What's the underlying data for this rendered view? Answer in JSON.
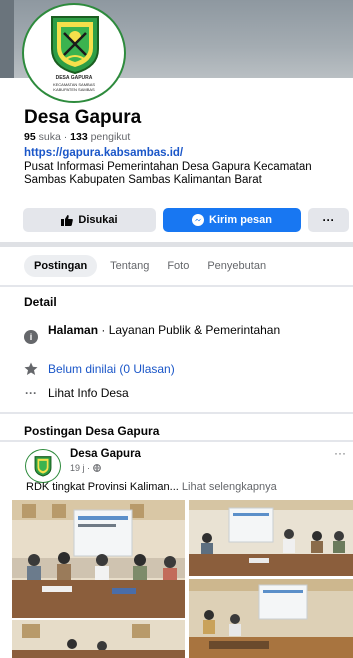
{
  "page": {
    "name": "Desa Gapura",
    "likes_count": "95",
    "likes_label": "suka",
    "followers_count": "133",
    "followers_label": "pengikut",
    "url": "https://gapura.kabsambas.id/",
    "description": "Pusat Informasi Pemerintahan Desa Gapura Kecamatan Sambas Kabupaten Sambas Kalimantan Barat"
  },
  "logo": {
    "line1": "DESA GAPURA",
    "line2": "KECAMATAN SAMBAS",
    "line3": "KABUPATEN SAMBAS"
  },
  "actions": {
    "like_label": "Disukai",
    "message_label": "Kirim pesan",
    "more_label": "···"
  },
  "tabs": [
    {
      "label": "Postingan",
      "active": true
    },
    {
      "label": "Tentang",
      "active": false
    },
    {
      "label": "Foto",
      "active": false
    },
    {
      "label": "Penyebutan",
      "active": false
    }
  ],
  "detail": {
    "title": "Detail",
    "category_bold": "Halaman",
    "category_rest": " · Layanan Publik & Pemerintahan",
    "rating": "Belum dinilai (0 Ulasan)",
    "more_info": "Lihat Info Desa"
  },
  "posts": {
    "section_title": "Postingan Desa Gapura",
    "items": [
      {
        "author": "Desa Gapura",
        "time": "19 j",
        "privacy_icon": "globe-icon",
        "text": "RDK tingkat Provinsi Kaliman...",
        "see_more": "Lihat selengkapnya"
      }
    ]
  },
  "icons": {
    "like": "thumbs-up-icon",
    "message": "messenger-icon",
    "info": "info-icon",
    "star": "star-icon",
    "ellipsis": "ellipsis-icon"
  },
  "colors": {
    "accent": "#1877f2",
    "link": "#1a56c8",
    "logo_green": "#2e8b3d",
    "secondary_text": "#65676b"
  }
}
